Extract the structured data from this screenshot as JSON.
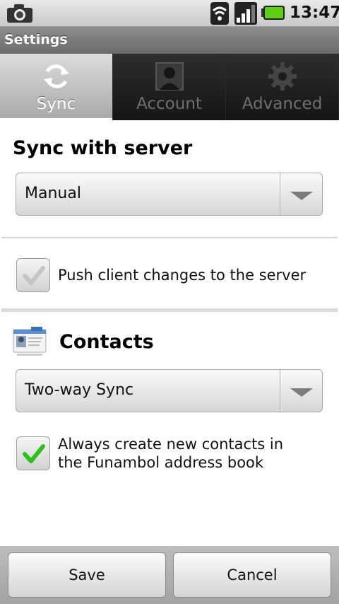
{
  "status_bar": {
    "time": "13:47",
    "icons": [
      "camera-icon",
      "wifi-icon",
      "signal-icon",
      "battery-icon"
    ],
    "battery_color": "#5ecf13"
  },
  "app": {
    "title": "Settings"
  },
  "tabs": [
    {
      "label": "Sync",
      "icon": "sync-icon",
      "active": true
    },
    {
      "label": "Account",
      "icon": "account-icon",
      "active": false
    },
    {
      "label": "Advanced",
      "icon": "gear-icon",
      "active": false
    }
  ],
  "sync": {
    "heading": "Sync with server",
    "mode_value": "Manual",
    "push_label": "Push client changes to the server",
    "push_checked": false
  },
  "contacts": {
    "heading": "Contacts",
    "mode_value": "Two-way Sync",
    "create_label_line1": "Always create new contacts in",
    "create_label_line2": "the Funambol address book",
    "create_checked": true
  },
  "buttons": {
    "save": "Save",
    "cancel": "Cancel"
  },
  "colors": {
    "check_green": "#2fbf1f",
    "title_bar": "#7a7a7a"
  }
}
